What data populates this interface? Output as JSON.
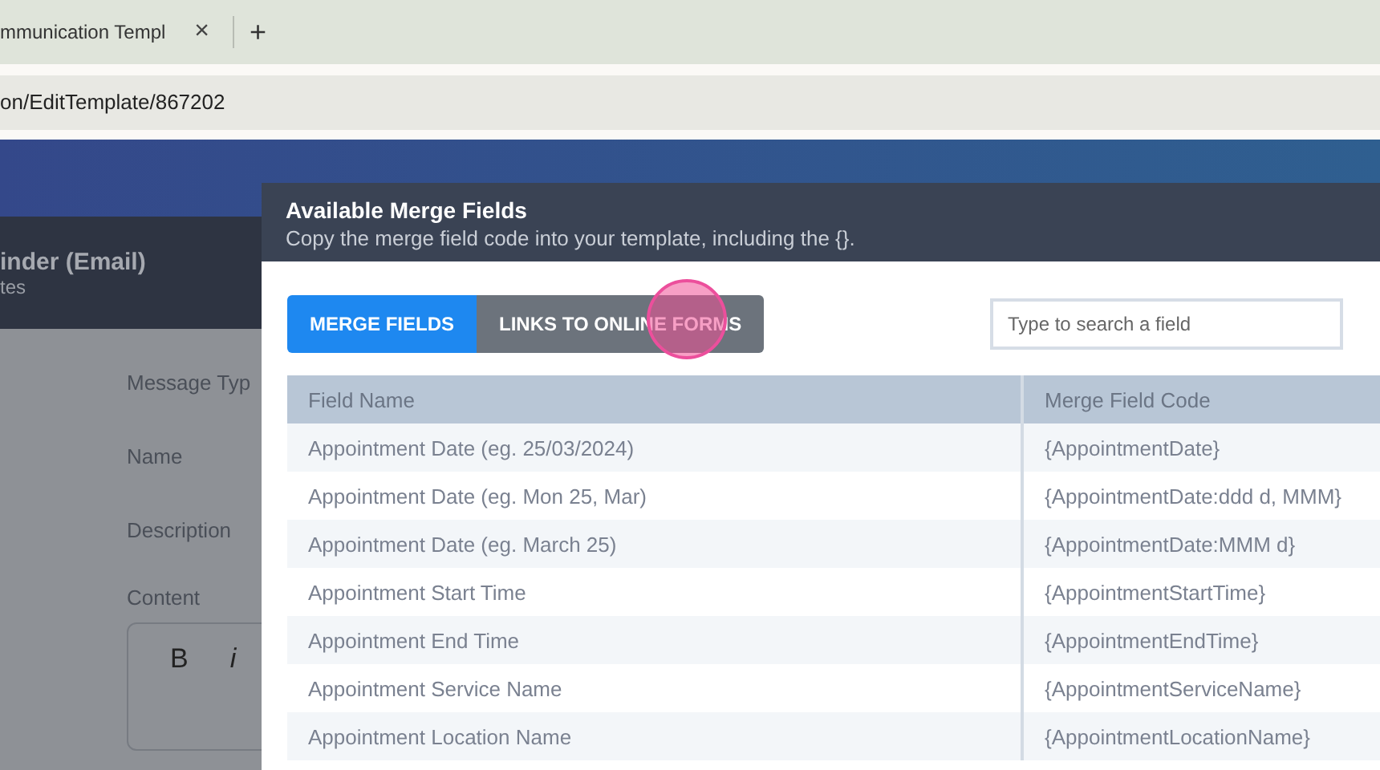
{
  "browser": {
    "tab_title": "mmunication Templ",
    "tab_close": "×",
    "new_tab": "+",
    "address": "on/EditTemplate/867202"
  },
  "page": {
    "title": "inder (Email)",
    "subtitle": "tes",
    "labels": [
      "Message Typ",
      "Name",
      "Description"
    ],
    "content_label": "Content",
    "editor_buttons": [
      {
        "label": "B",
        "kind": "bold"
      },
      {
        "label": "i",
        "kind": "italic"
      }
    ]
  },
  "modal": {
    "title": "Available Merge Fields",
    "subtitle": "Copy the merge field code into your template, including the {}.",
    "tabs": [
      {
        "label": "MERGE FIELDS",
        "selected": true
      },
      {
        "label": "LINKS TO ONLINE FORMS",
        "selected": false
      }
    ],
    "search": {
      "placeholder": "Type to search a field"
    },
    "table": {
      "columns": [
        "Field Name",
        "Merge Field Code"
      ],
      "rows": [
        [
          "Appointment Date (eg. 25/03/2024)",
          "{AppointmentDate}"
        ],
        [
          "Appointment Date (eg. Mon 25, Mar)",
          "{AppointmentDate:ddd d, MMM}"
        ],
        [
          "Appointment Date (eg. March 25)",
          "{AppointmentDate:MMM d}"
        ],
        [
          "Appointment Start Time",
          "{AppointmentStartTime}"
        ],
        [
          "Appointment End Time",
          "{AppointmentEndTime}"
        ],
        [
          "Appointment Service Name",
          "{AppointmentServiceName}"
        ],
        [
          "Appointment Location Name",
          "{AppointmentLocationName}"
        ]
      ]
    }
  }
}
